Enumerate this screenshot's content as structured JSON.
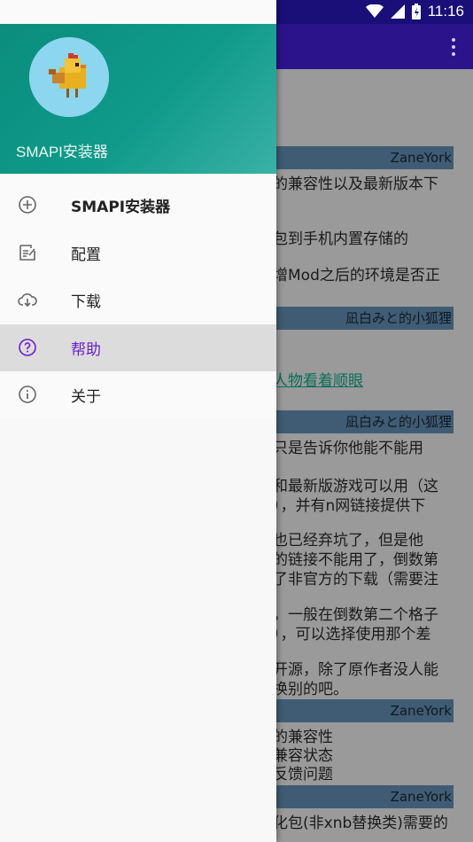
{
  "status_bar": {
    "time": "11:16",
    "left_icons": [
      "download-icon",
      "hms-icon",
      "a-icon"
    ],
    "right_icons": [
      "wifi-icon",
      "signal-icon",
      "battery-icon"
    ]
  },
  "drawer": {
    "header_title": "SMAPI安装器",
    "items": [
      {
        "label": "SMAPI安装器",
        "icon": "add-circle-icon",
        "active": false,
        "bold": true
      },
      {
        "label": "配置",
        "icon": "edit-note-icon",
        "active": false
      },
      {
        "label": "下载",
        "icon": "cloud-download-icon",
        "active": false
      },
      {
        "label": "帮助",
        "icon": "help-circle-icon",
        "active": true
      },
      {
        "label": "关于",
        "icon": "info-circle-icon",
        "active": false
      }
    ]
  },
  "background": {
    "bands": [
      "ZaneYork",
      "凪白みと的小狐狸",
      "凪白みと的小狐狸",
      "ZaneYork",
      "ZaneYork"
    ],
    "lines": [
      "的兼容性以及最新版本下",
      "包到手机内置存储的",
      "增Mod之后的环境是否正",
      "人物看着顺眼",
      "只是告诉你他能不能用",
      "和最新版游戏可以用（这",
      "），并有n网链接提供下",
      "也已经弃坑了，但是他",
      "的链接不能用了，倒数第",
      "了非官方的下载（需要注",
      "，一般在倒数第二个格子",
      "），可以选择使用那个差",
      "开源，除了原作者没人能",
      "换别的吧。",
      "的兼容性",
      "兼容状态",
      "反馈问题",
      "化包(非xnb替换类)需要的"
    ]
  },
  "colors": {
    "appbar": "#2b138c",
    "drawer_header": "#0f9a8a",
    "active_text": "#6a1fc8"
  }
}
